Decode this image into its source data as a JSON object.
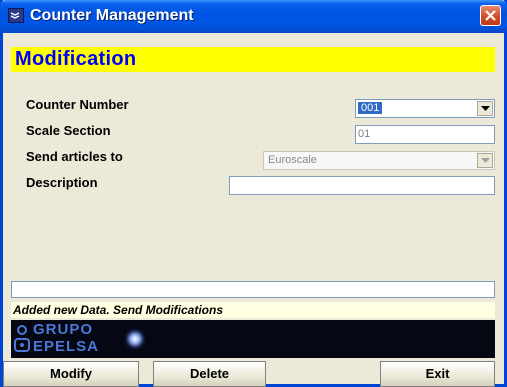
{
  "window": {
    "title": "Counter Management"
  },
  "header": {
    "title": "Modification"
  },
  "form": {
    "counter_number": {
      "label": "Counter Number",
      "value": "001"
    },
    "scale_section": {
      "label": "Scale Section",
      "value": "01"
    },
    "send_articles_to": {
      "label": "Send articles to",
      "value": "Euroscale"
    },
    "description": {
      "label": "Description",
      "value": ""
    }
  },
  "status": {
    "message": "Added new Data. Send Modifications"
  },
  "logo": {
    "line1": "GRUPO",
    "line2": "EPELSA"
  },
  "buttons": {
    "modify": "Modify",
    "delete": "Delete",
    "exit": "Exit"
  },
  "colors": {
    "header_band": "#ffff00",
    "header_text": "#0000ff",
    "titlebar": "#0054e3",
    "close_button": "#d14a22"
  }
}
